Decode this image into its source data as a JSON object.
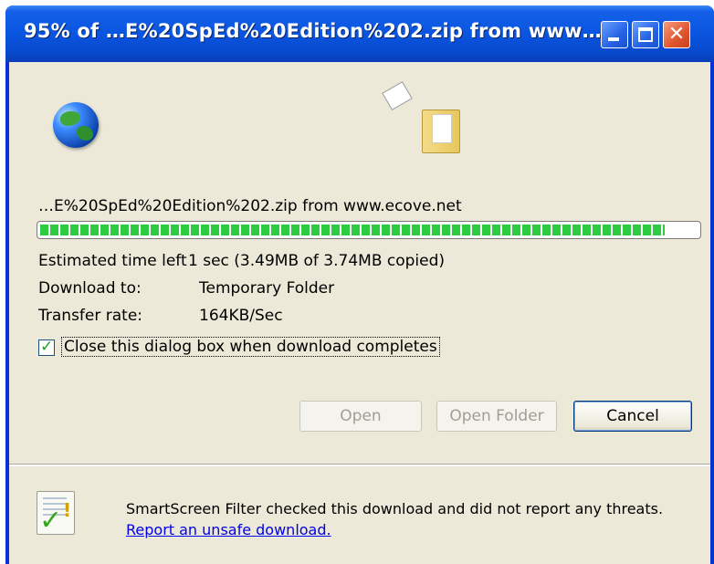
{
  "window": {
    "title": "95% of …E%20SpEd%20Edition%202.zip from www…"
  },
  "download": {
    "source_line": "…E%20SpEd%20Edition%202.zip from www.ecove.net",
    "progress_percent": 95,
    "estimated_label": "Estimated time left",
    "estimated_value": "1 sec (3.49MB of 3.74MB copied)",
    "download_to_label": "Download to:",
    "download_to_value": "Temporary Folder",
    "transfer_rate_label": "Transfer rate:",
    "transfer_rate_value": "164KB/Sec",
    "close_when_done_label": "Close this dialog box when download completes",
    "close_when_done_checked": true
  },
  "buttons": {
    "open": "Open",
    "open_folder": "Open Folder",
    "cancel": "Cancel"
  },
  "smartscreen": {
    "message": "SmartScreen Filter checked this download and did not report any threats.",
    "link": "Report an unsafe download."
  },
  "icons": [
    "globe-icon",
    "flying-paper-icon",
    "folder-icon",
    "minimize-icon",
    "maximize-icon",
    "close-icon",
    "checkmark-icon",
    "smartscreen-shield-icon"
  ]
}
